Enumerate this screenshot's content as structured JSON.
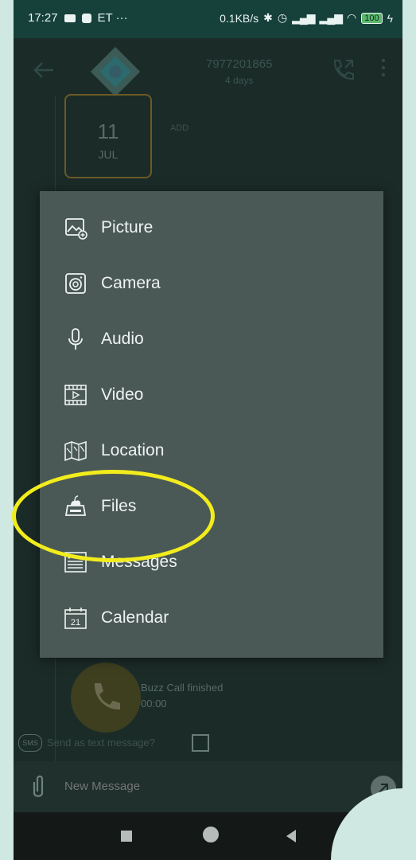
{
  "status_bar": {
    "time": "17:27",
    "left_icons_text": "ET  ···",
    "net_speed": "0.1KB/s",
    "battery": "100"
  },
  "header": {
    "contact_number": "7977201865",
    "contact_subtitle": "4 days"
  },
  "chat": {
    "calendar_day": "11",
    "calendar_month": "JUL",
    "add_label": "ADD",
    "buzz_title": "Buzz Call finished",
    "buzz_time": "00:00",
    "sms_badge": "SMS",
    "sms_label": "Send as text message?"
  },
  "compose": {
    "placeholder": "New Message"
  },
  "attach_menu": {
    "items": [
      {
        "label": "Picture",
        "icon": "picture-icon"
      },
      {
        "label": "Camera",
        "icon": "camera-icon"
      },
      {
        "label": "Audio",
        "icon": "microphone-icon"
      },
      {
        "label": "Video",
        "icon": "video-icon"
      },
      {
        "label": "Location",
        "icon": "map-icon"
      },
      {
        "label": "Files",
        "icon": "files-icon"
      },
      {
        "label": "Messages",
        "icon": "messages-icon"
      },
      {
        "label": "Calendar",
        "icon": "calendar-icon"
      }
    ],
    "calendar_icon_number": "21"
  },
  "colors": {
    "highlight": "#f2ec1d",
    "menu_bg": "#4a5955",
    "status_bar_bg": "#16403a"
  }
}
